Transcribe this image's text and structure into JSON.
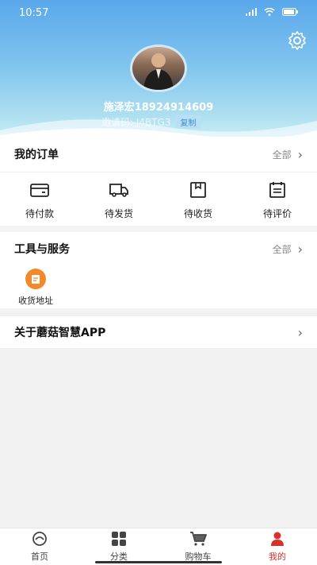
{
  "status": {
    "time": "10:57",
    "battery": ""
  },
  "profile": {
    "name": "施泽宏18924914609",
    "invite_label": "邀请码: J4BTG3",
    "copy_label": "复制"
  },
  "orders": {
    "title": "我的订单",
    "all_label": "全部",
    "items": [
      {
        "label": "待付款",
        "icon": "wallet-icon"
      },
      {
        "label": "待发货",
        "icon": "truck-icon"
      },
      {
        "label": "待收货",
        "icon": "box-icon"
      },
      {
        "label": "待评价",
        "icon": "review-icon"
      }
    ]
  },
  "tools": {
    "title": "工具与服务",
    "all_label": "全部",
    "items": [
      {
        "label": "收货地址",
        "icon": "address-icon"
      }
    ]
  },
  "about": {
    "title": "关于蘑菇智慧APP"
  },
  "tabs": [
    {
      "label": "首页",
      "icon": "home-icon"
    },
    {
      "label": "分类",
      "icon": "grid-icon"
    },
    {
      "label": "购物车",
      "icon": "cart-icon"
    },
    {
      "label": "我的",
      "icon": "person-icon",
      "active": true
    }
  ],
  "colors": {
    "accent": "#d9302c",
    "header_top": "#5aa8ec",
    "tool_icon": "#f38a2a"
  }
}
